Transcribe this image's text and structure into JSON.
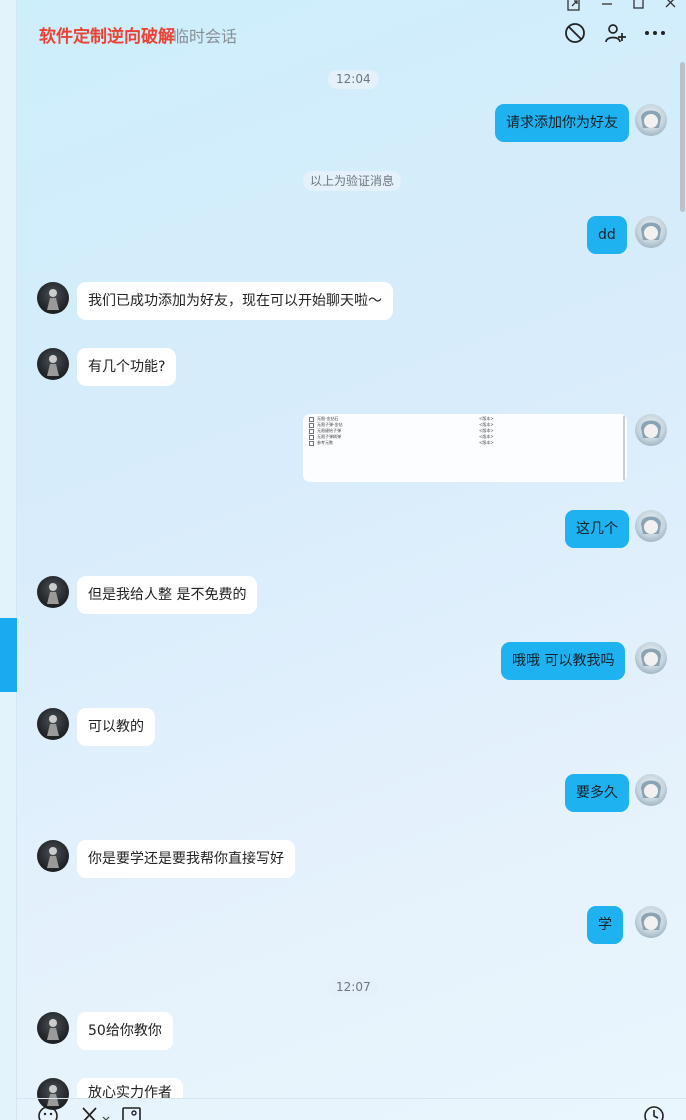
{
  "header": {
    "title": "软件定制逆向破解",
    "subtitle": "临时会话"
  },
  "icons": {
    "window_pin": "pin-window-icon",
    "minimize": "minimize-icon",
    "maximize": "maximize-icon",
    "close": "close-icon",
    "block": "block-icon",
    "add_friend": "add-friend-icon",
    "more": "more-options-icon",
    "emoji": "emoji-icon",
    "scissors": "screenshot-scissors-icon",
    "image": "image-icon",
    "history": "history-clock-icon"
  },
  "colors": {
    "title": "#ea4335",
    "outgoing_bubble": "#1fb2f0",
    "incoming_bubble": "#ffffff",
    "accent": "#19aaf0"
  },
  "chat": {
    "time1": "12:04",
    "time2": "12:07",
    "notice": "以上为验证消息",
    "m1": "请求添加你为好友",
    "m2": "dd",
    "m3": "我们已成功添加为好友，现在可以开始聊天啦～",
    "m4": "有几个功能?",
    "m5": "这几个",
    "m6": "但是我给人整 是不免费的",
    "m7": "哦哦  可以教我吗",
    "m8": "可以教的",
    "m9": "要多久",
    "m10": "你是要学还是要我帮你直接写好",
    "m11": "学",
    "m12": "50给你教你",
    "m13": "放心实力作者"
  },
  "image_message": {
    "rows": [
      {
        "name": "无限-金钻石",
        "value": "<版本>"
      },
      {
        "name": "无限子弹-金钻",
        "value": "<版本>"
      },
      {
        "name": "无限键给子弹",
        "value": "<版本>"
      },
      {
        "name": "无限子弹刷弹",
        "value": "<版本>"
      },
      {
        "name": "参考元数",
        "value": "<版本>"
      }
    ]
  }
}
